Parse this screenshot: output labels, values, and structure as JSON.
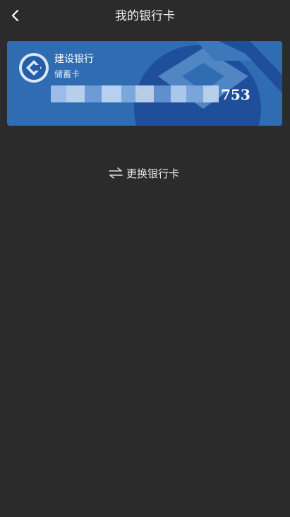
{
  "nav": {
    "title": "我的银行卡",
    "back_icon": "chevron-left-icon"
  },
  "card": {
    "bank_name": "建设银行",
    "card_type": "储蓄卡",
    "card_number_tail": "753",
    "logo_icon": "ccb-logo-icon",
    "background_color": "#2f6cb2",
    "watermark_color": "#1f4f9b"
  },
  "actions": {
    "change_card_label": "更换银行卡",
    "change_card_icon": "swap-arrows-icon"
  },
  "colors": {
    "page_background": "#2b2b2b",
    "text_primary": "#ffffff"
  }
}
